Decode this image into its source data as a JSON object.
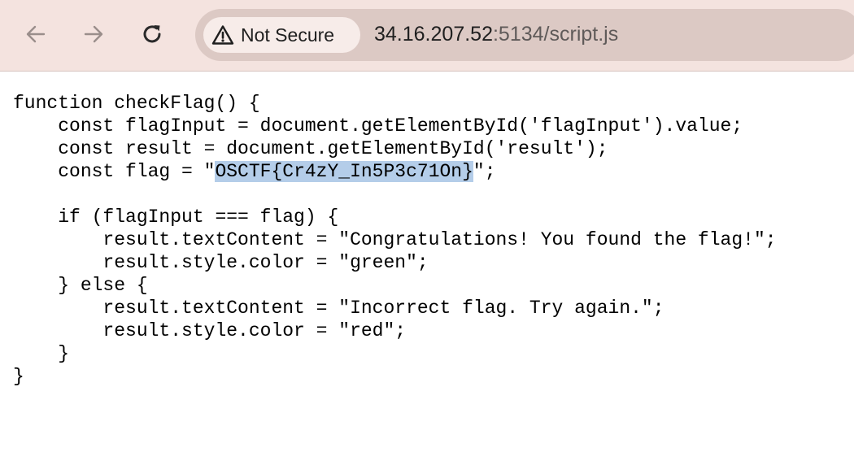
{
  "browser": {
    "security_label": "Not Secure",
    "url_host": "34.16.207.52",
    "url_rest": ":5134/script.js",
    "icons": {
      "back": "arrow-left-icon",
      "forward": "arrow-right-icon",
      "reload": "reload-icon",
      "security": "warning-triangle-icon"
    }
  },
  "code": {
    "lines": [
      "function checkFlag() {",
      "    const flagInput = document.getElementById('flagInput').value;",
      "    const result = document.getElementById('result');",
      "    const flag = \"",
      "",
      "    if (flagInput === flag) {",
      "        result.textContent = \"Congratulations! You found the flag!\";",
      "        result.style.color = \"green\";",
      "    } else {",
      "        result.textContent = \"Incorrect flag. Try again.\";",
      "        result.style.color = \"red\";",
      "    }",
      "}"
    ],
    "flag_selected": "OSCTF{Cr4zY_In5P3c71On}",
    "flag_line_suffix": "\";"
  },
  "colors": {
    "toolbar_bg": "#f4e3df",
    "omnibox_bg": "#dcc9c4",
    "chip_bg": "#f7ece9",
    "selection_bg": "#b4cde9"
  }
}
